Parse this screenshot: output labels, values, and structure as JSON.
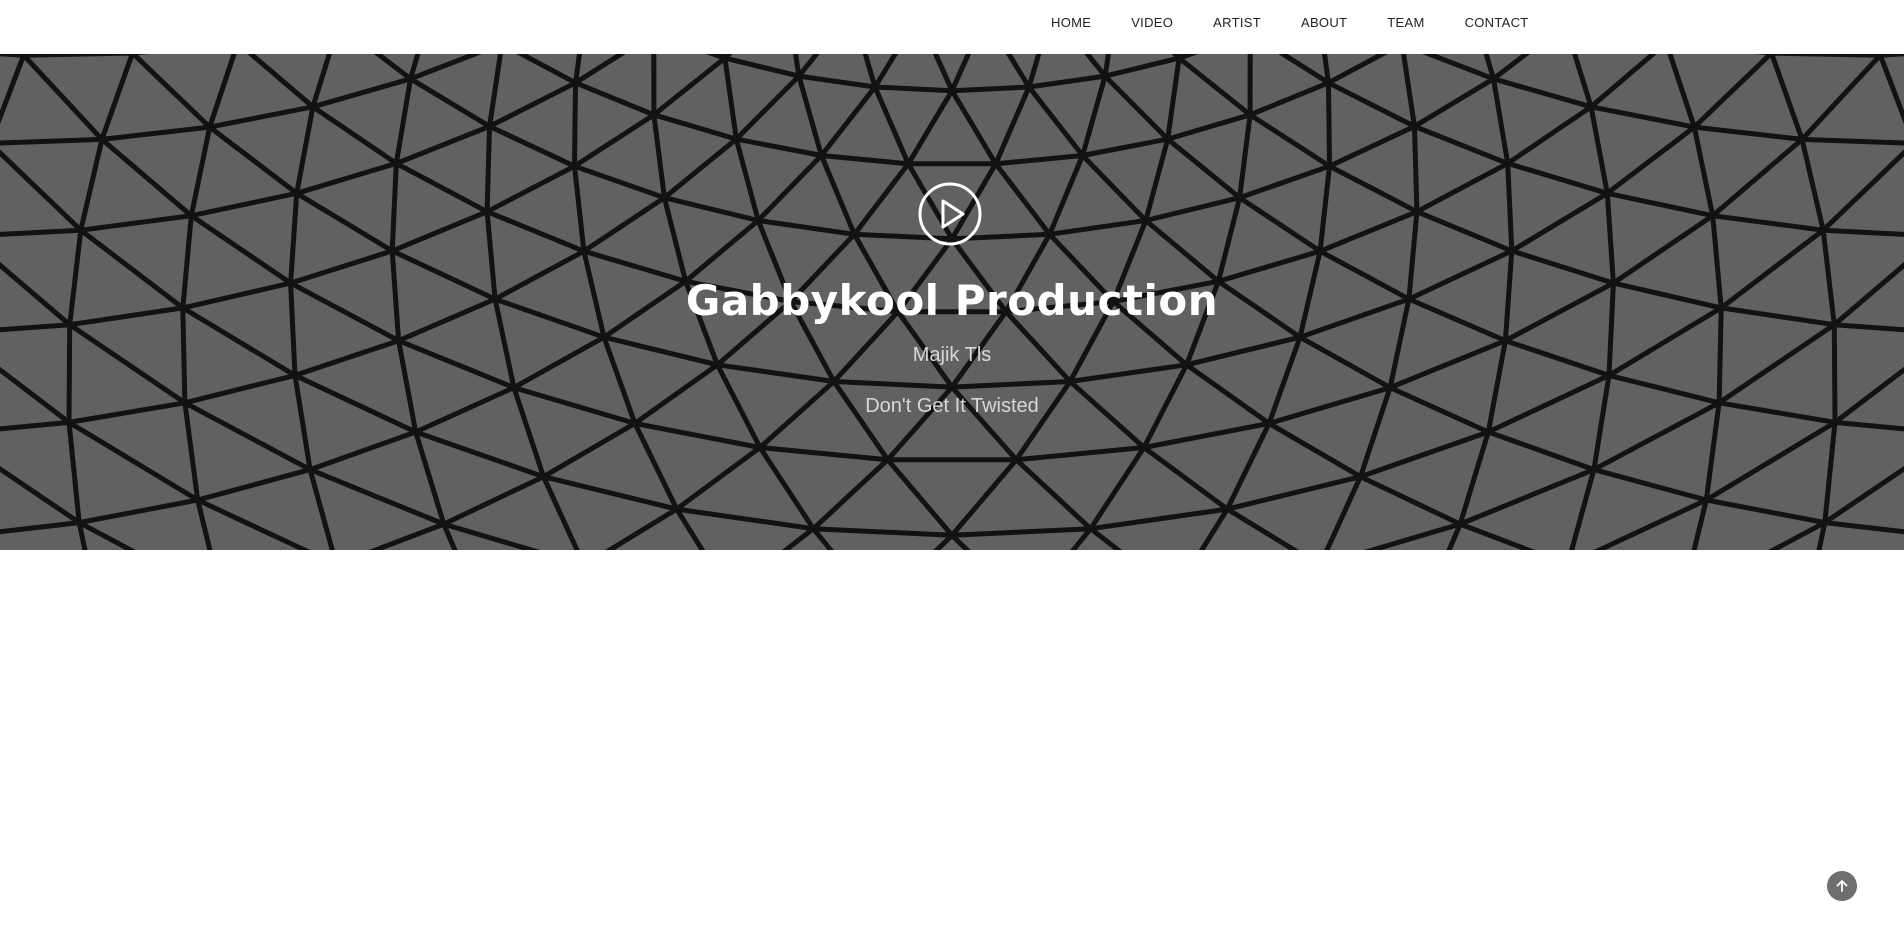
{
  "nav": {
    "items": [
      {
        "label": "HOME"
      },
      {
        "label": "VIDEO"
      },
      {
        "label": "ARTIST"
      },
      {
        "label": "ABOUT"
      },
      {
        "label": "TEAM"
      },
      {
        "label": "CONTACT"
      }
    ]
  },
  "hero": {
    "title": "Gabbykool Production",
    "subtitle": "Majik Tls",
    "tagline": "Don't Get It Twisted",
    "play_icon": "play-circle-icon",
    "background": "geodesic-glass-roof-photo"
  },
  "back_to_top": {
    "icon": "arrow-up-icon"
  },
  "colors": {
    "hero_overlay": "#6b6b6b",
    "nav_text": "#222222",
    "hero_title": "#ffffff",
    "hero_text": "#d8d8d8",
    "to_top_bg": "#6e6e6e"
  }
}
